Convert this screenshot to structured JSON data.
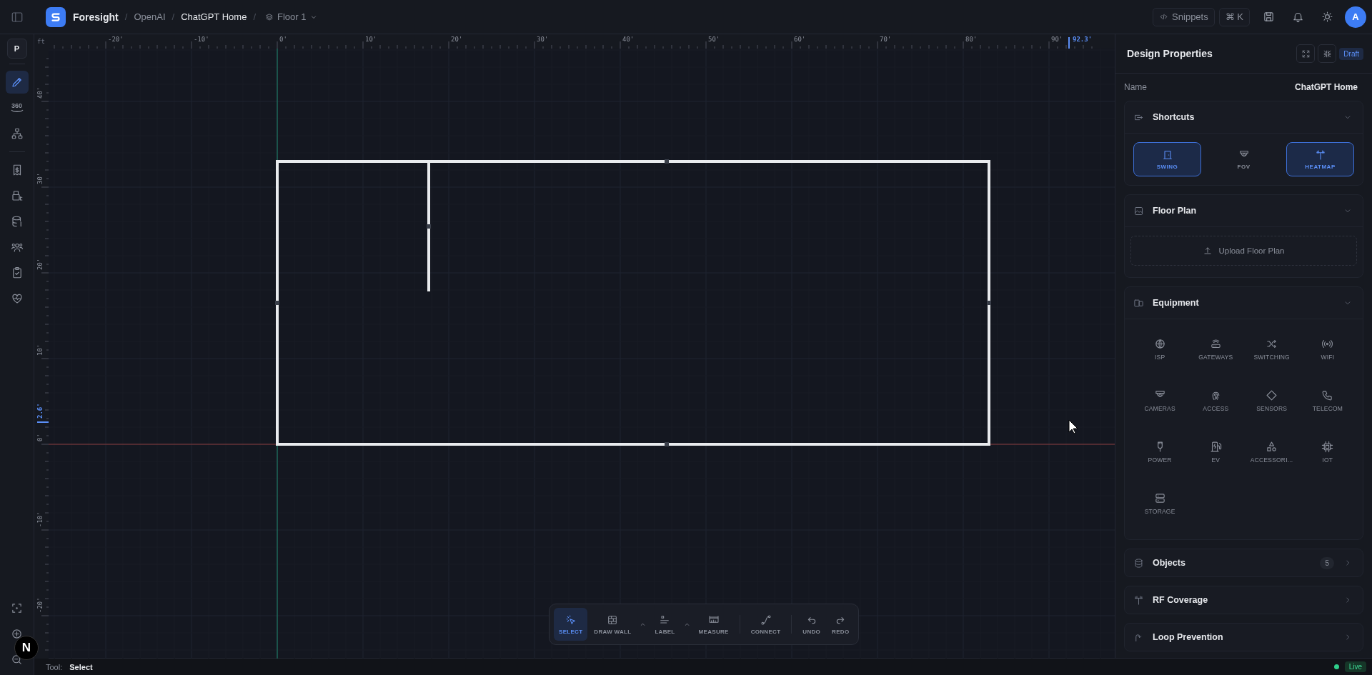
{
  "topbar": {
    "app_name": "Foresight",
    "separator": "/",
    "breadcrumbs": [
      "OpenAI",
      "ChatGPT Home"
    ],
    "floor": "Floor 1",
    "snippets": "Snippets",
    "shortcut": "⌘ K",
    "avatar": "A"
  },
  "rail": {
    "badge": "P",
    "groups": [
      [
        {
          "kind": "pencil",
          "selected": true
        },
        {
          "kind": "view360",
          "label": "360",
          "selected": false
        },
        {
          "kind": "hierarchy",
          "selected": false
        }
      ],
      [
        {
          "kind": "receipt",
          "selected": false
        },
        {
          "kind": "register",
          "selected": false
        },
        {
          "kind": "db_dollar",
          "selected": false
        },
        {
          "kind": "people",
          "selected": false
        },
        {
          "kind": "clipboard",
          "selected": false
        },
        {
          "kind": "heart",
          "selected": false
        }
      ]
    ],
    "bottom": [
      {
        "kind": "focus"
      },
      {
        "kind": "zoom_in"
      },
      {
        "kind": "zoom_out"
      }
    ],
    "corner_badge": "N"
  },
  "ruler": {
    "unit": "ft",
    "x_labels": [
      "-20'",
      "-10'",
      "0'",
      "10'",
      "20'",
      "30'",
      "40'",
      "50'",
      "60'",
      "70'",
      "80'",
      "90'"
    ],
    "x_marker": "92.3'",
    "y_labels": [
      "40'",
      "30'",
      "20'",
      "10'",
      "0'",
      "-10'",
      "-20'"
    ],
    "y_marker": "2.6'"
  },
  "tools": [
    {
      "kind": "select",
      "label": "SELECT",
      "selected": true,
      "has_menu": false,
      "divider_before": false
    },
    {
      "kind": "wall",
      "label": "DRAW WALL",
      "selected": false,
      "has_menu": true,
      "divider_before": false
    },
    {
      "kind": "label",
      "label": "LABEL",
      "selected": false,
      "has_menu": true,
      "divider_before": false
    },
    {
      "kind": "measure",
      "label": "MEASURE",
      "selected": false,
      "has_menu": false,
      "divider_before": false
    },
    {
      "kind": "connect",
      "label": "CONNECT",
      "selected": false,
      "has_menu": false,
      "divider_before": true
    },
    {
      "kind": "undo",
      "label": "UNDO",
      "selected": false,
      "has_menu": false,
      "divider_before": true
    },
    {
      "kind": "redo",
      "label": "REDO",
      "selected": false,
      "has_menu": false,
      "divider_before": false
    }
  ],
  "panel": {
    "title": "Design Properties",
    "status": "Draft",
    "name_label": "Name",
    "name_value": "ChatGPT Home",
    "sections": [
      {
        "kind": "shortcuts",
        "title": "Shortcuts",
        "expanded": true,
        "items": [
          {
            "kind": "door",
            "label": "SWING",
            "selected": true
          },
          {
            "kind": "camera",
            "label": "FOV",
            "selected": false
          },
          {
            "kind": "antenna",
            "label": "HEATMAP",
            "selected": true
          }
        ]
      },
      {
        "kind": "floor_plan",
        "title": "Floor Plan",
        "expanded": true,
        "upload": "Upload Floor Plan"
      },
      {
        "kind": "equipment",
        "title": "Equipment",
        "expanded": true,
        "items": [
          {
            "kind": "globe",
            "label": "ISP"
          },
          {
            "kind": "router",
            "label": "GATEWAYS"
          },
          {
            "kind": "shuffle",
            "label": "SWITCHING"
          },
          {
            "kind": "radio",
            "label": "WIFI"
          },
          {
            "kind": "camera",
            "label": "CAMERAS"
          },
          {
            "kind": "fingerprint",
            "label": "ACCESS"
          },
          {
            "kind": "diamond",
            "label": "SENSORS"
          },
          {
            "kind": "phone",
            "label": "TELECOM"
          },
          {
            "kind": "plug",
            "label": "POWER"
          },
          {
            "kind": "ev",
            "label": "EV"
          },
          {
            "kind": "shapes",
            "label": "ACCESSORI..."
          },
          {
            "kind": "chip",
            "label": "IOT"
          },
          {
            "kind": "server",
            "label": "STORAGE"
          }
        ]
      },
      {
        "kind": "objects",
        "title": "Objects",
        "expanded": false,
        "count": "5"
      },
      {
        "kind": "rf",
        "title": "RF Coverage",
        "expanded": false
      },
      {
        "kind": "loop",
        "title": "Loop Prevention",
        "expanded": false
      }
    ]
  },
  "status_bar": {
    "tool_label": "Tool:",
    "tool_value": "Select",
    "live": "Live"
  }
}
